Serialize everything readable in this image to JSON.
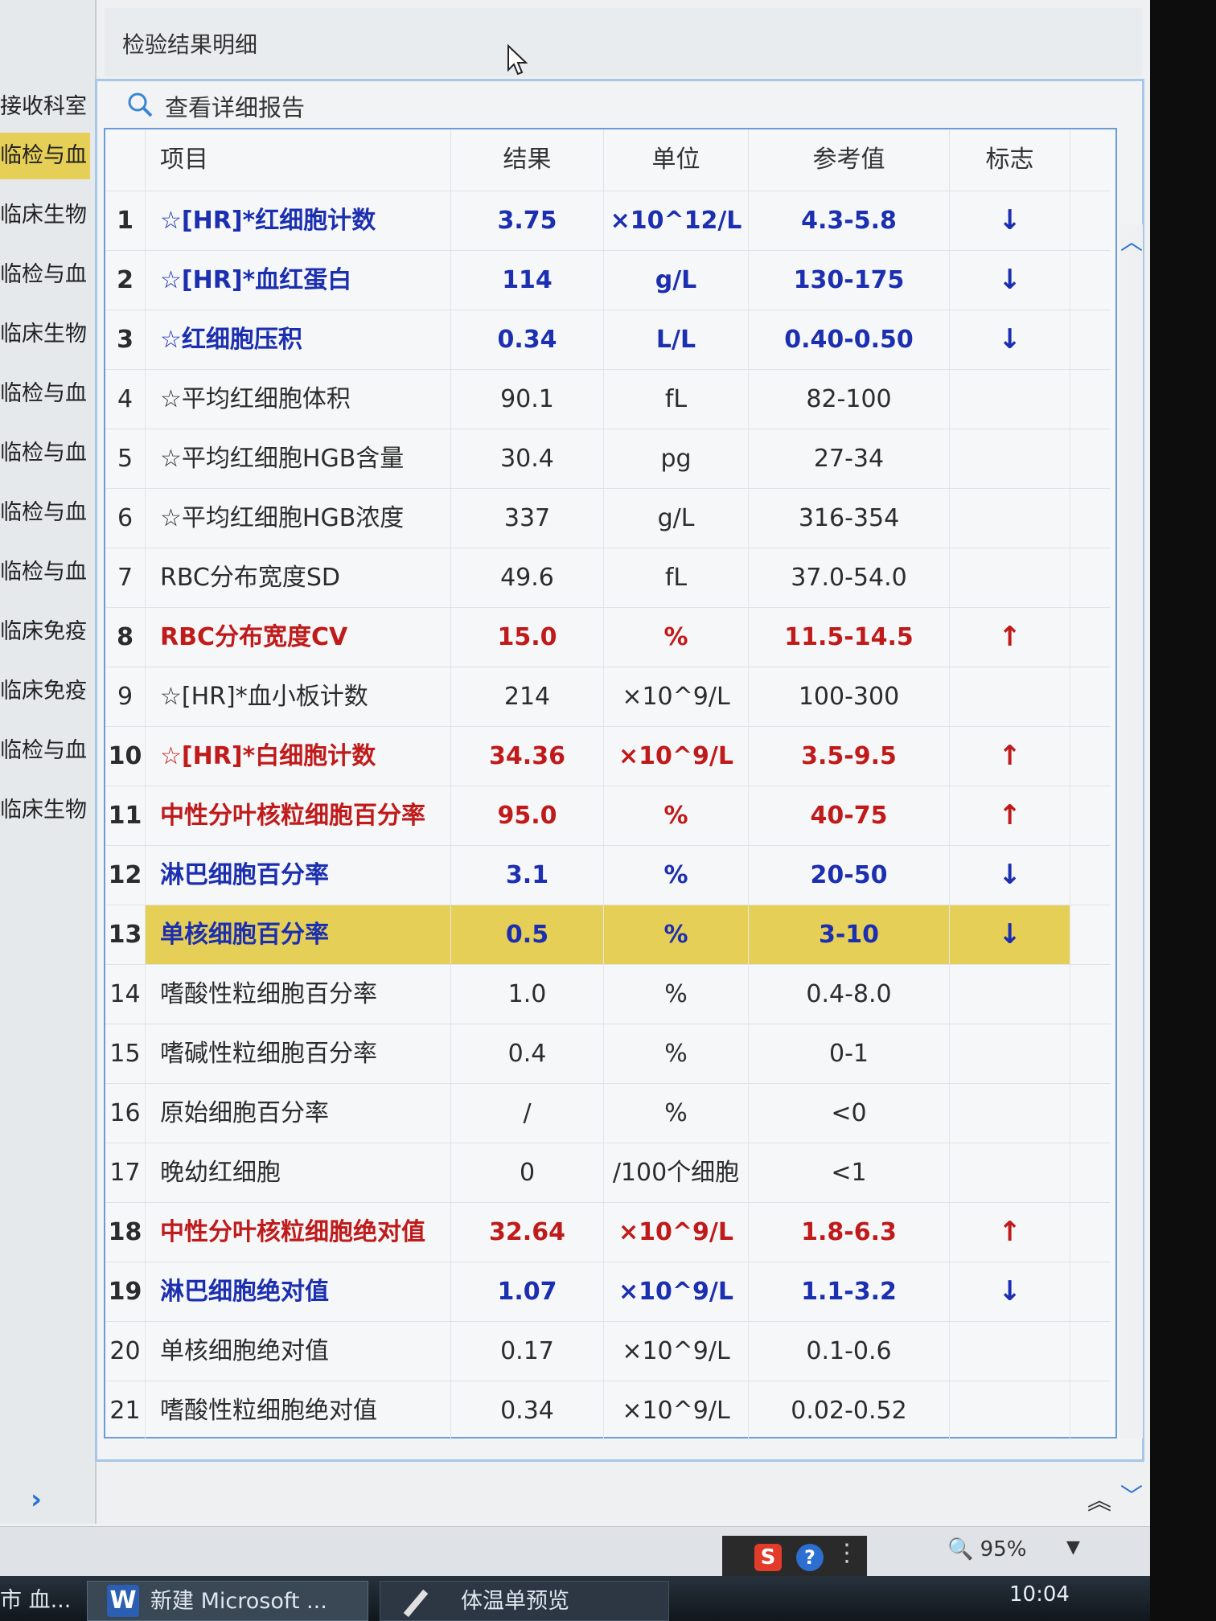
{
  "window": {
    "title": "检验结果明细"
  },
  "toolbar": {
    "view_detail_label": "查看详细报告"
  },
  "left_panel": {
    "header": "接收科室",
    "items": [
      {
        "label": "临检与血",
        "selected": true
      },
      {
        "label": "临床生物",
        "selected": false
      },
      {
        "label": "临检与血",
        "selected": false
      },
      {
        "label": "临床生物",
        "selected": false
      },
      {
        "label": "临检与血",
        "selected": false
      },
      {
        "label": "临检与血",
        "selected": false
      },
      {
        "label": "临检与血",
        "selected": false
      },
      {
        "label": "临检与血",
        "selected": false
      },
      {
        "label": "临床免疫",
        "selected": false
      },
      {
        "label": "临床免疫",
        "selected": false
      },
      {
        "label": "临检与血",
        "selected": false
      },
      {
        "label": "临床生物",
        "selected": false
      }
    ],
    "expand_icon": "chevron-right-icon"
  },
  "table": {
    "headers": {
      "item": "项目",
      "result": "结果",
      "unit": "单位",
      "reference": "参考值",
      "flag": "标志"
    },
    "rows": [
      {
        "no": "1",
        "name": "☆[HR]*红细胞计数",
        "result": "3.75",
        "unit": "×10^12/L",
        "ref": "4.3-5.8",
        "flag": "↓",
        "status": "low"
      },
      {
        "no": "2",
        "name": "☆[HR]*血红蛋白",
        "result": "114",
        "unit": "g/L",
        "ref": "130-175",
        "flag": "↓",
        "status": "low"
      },
      {
        "no": "3",
        "name": "☆红细胞压积",
        "result": "0.34",
        "unit": "L/L",
        "ref": "0.40-0.50",
        "flag": "↓",
        "status": "low"
      },
      {
        "no": "4",
        "name": "☆平均红细胞体积",
        "result": "90.1",
        "unit": "fL",
        "ref": "82-100",
        "flag": "",
        "status": "normal"
      },
      {
        "no": "5",
        "name": "☆平均红细胞HGB含量",
        "result": "30.4",
        "unit": "pg",
        "ref": "27-34",
        "flag": "",
        "status": "normal"
      },
      {
        "no": "6",
        "name": "☆平均红细胞HGB浓度",
        "result": "337",
        "unit": "g/L",
        "ref": "316-354",
        "flag": "",
        "status": "normal"
      },
      {
        "no": "7",
        "name": "RBC分布宽度SD",
        "result": "49.6",
        "unit": "fL",
        "ref": "37.0-54.0",
        "flag": "",
        "status": "normal"
      },
      {
        "no": "8",
        "name": "RBC分布宽度CV",
        "result": "15.0",
        "unit": "%",
        "ref": "11.5-14.5",
        "flag": "↑",
        "status": "high"
      },
      {
        "no": "9",
        "name": "☆[HR]*血小板计数",
        "result": "214",
        "unit": "×10^9/L",
        "ref": "100-300",
        "flag": "",
        "status": "normal"
      },
      {
        "no": "10",
        "name": "☆[HR]*白细胞计数",
        "result": "34.36",
        "unit": "×10^9/L",
        "ref": "3.5-9.5",
        "flag": "↑",
        "status": "high"
      },
      {
        "no": "11",
        "name": "中性分叶核粒细胞百分率",
        "result": "95.0",
        "unit": "%",
        "ref": "40-75",
        "flag": "↑",
        "status": "high"
      },
      {
        "no": "12",
        "name": "淋巴细胞百分率",
        "result": "3.1",
        "unit": "%",
        "ref": "20-50",
        "flag": "↓",
        "status": "low"
      },
      {
        "no": "13",
        "name": "单核细胞百分率",
        "result": "0.5",
        "unit": "%",
        "ref": "3-10",
        "flag": "↓",
        "status": "low",
        "highlight": true
      },
      {
        "no": "14",
        "name": "嗜酸性粒细胞百分率",
        "result": "1.0",
        "unit": "%",
        "ref": "0.4-8.0",
        "flag": "",
        "status": "normal"
      },
      {
        "no": "15",
        "name": "嗜碱性粒细胞百分率",
        "result": "0.4",
        "unit": "%",
        "ref": "0-1",
        "flag": "",
        "status": "normal"
      },
      {
        "no": "16",
        "name": "原始细胞百分率",
        "result": "/",
        "unit": "%",
        "ref": "<0",
        "flag": "",
        "status": "normal"
      },
      {
        "no": "17",
        "name": "晚幼红细胞",
        "result": "0",
        "unit": "/100个细胞",
        "ref": "<1",
        "flag": "",
        "status": "normal"
      },
      {
        "no": "18",
        "name": "中性分叶核粒细胞绝对值",
        "result": "32.64",
        "unit": "×10^9/L",
        "ref": "1.8-6.3",
        "flag": "↑",
        "status": "high"
      },
      {
        "no": "19",
        "name": "淋巴细胞绝对值",
        "result": "1.07",
        "unit": "×10^9/L",
        "ref": "1.1-3.2",
        "flag": "↓",
        "status": "low"
      },
      {
        "no": "20",
        "name": "单核细胞绝对值",
        "result": "0.17",
        "unit": "×10^9/L",
        "ref": "0.1-0.6",
        "flag": "",
        "status": "normal"
      },
      {
        "no": "21",
        "name": "嗜酸性粒细胞绝对值",
        "result": "0.34",
        "unit": "×10^9/L",
        "ref": "0.02-0.52",
        "flag": "",
        "status": "normal"
      }
    ]
  },
  "status_bar": {
    "zoom": "95%",
    "ime_s": "S",
    "ime_help": "?"
  },
  "taskbar": {
    "item1": "市 血...",
    "item2": "新建 Microsoft ...",
    "item3": "体温单预览",
    "clock": "10:04"
  },
  "colors": {
    "low": "#1b2fb0",
    "high": "#c01a1a",
    "highlight": "#e6cf57",
    "accent": "#2a72d0"
  }
}
